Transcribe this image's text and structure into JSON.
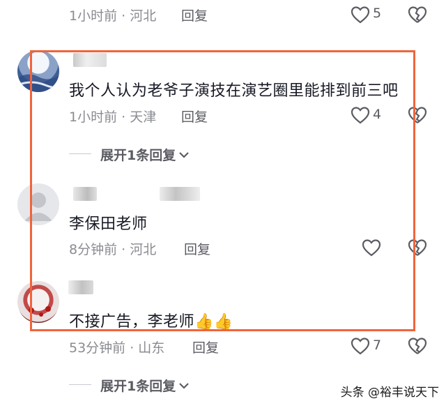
{
  "top_partial": {
    "meta": "1小时前 · 河北",
    "reply": "回复",
    "like_count": "5"
  },
  "comments": [
    {
      "text": "我个人认为老爷子演技在演艺圈里能排到前三吧",
      "meta": "1小时前 · 天津",
      "reply": "回复",
      "like_count": "4",
      "expand": "展开1条回复"
    },
    {
      "text": "李保田老师",
      "meta": "8分钟前 · 河北",
      "reply": "回复",
      "like_count": ""
    },
    {
      "text": "不接广告，李老师👍👍",
      "meta": "53分钟前 · 山东",
      "reply": "回复",
      "like_count": "7",
      "expand": "展开1条回复"
    }
  ],
  "watermark": "头条 @裕丰说天下",
  "colors": {
    "highlight": "#f0643c",
    "text": "#161823",
    "meta": "#8a8b91"
  },
  "icons": [
    "heart-icon",
    "broken-heart-icon",
    "chevron-down-icon",
    "default-avatar-icon"
  ]
}
